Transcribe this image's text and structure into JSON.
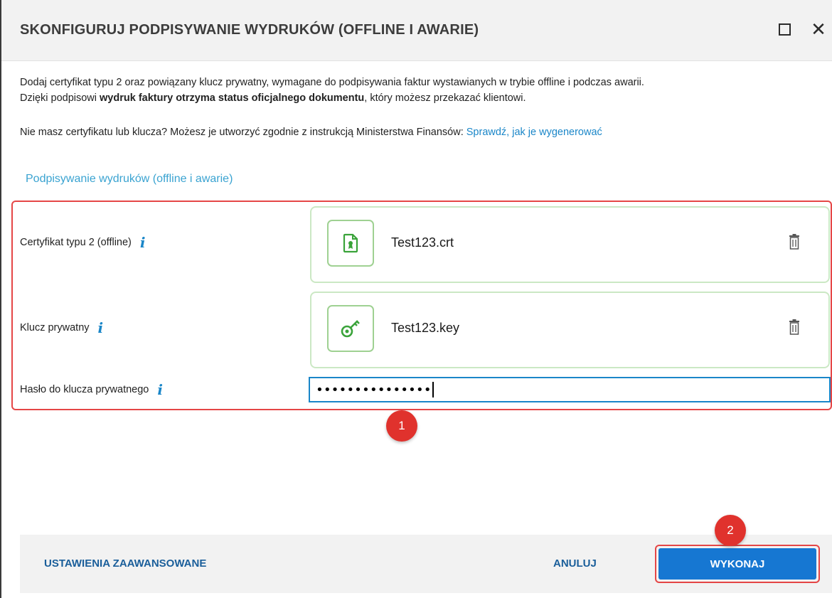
{
  "dialog": {
    "title": "SKONFIGURUJ PODPISYWANIE WYDRUKÓW (OFFLINE I AWARIE)",
    "maximize_icon": "maximize-icon",
    "close_icon": "close-icon",
    "close_glyph": "✕"
  },
  "intro": {
    "line1": "Dodaj certyfikat typu 2 oraz powiązany klucz prywatny, wymagane do podpisywania faktur wystawianych w trybie offline i podczas awarii.",
    "line2_pre": "Dzięki podpisowi ",
    "line2_bold": "wydruk faktury otrzyma status oficjalnego dokumentu",
    "line2_post": ", który możesz przekazać klientowi.",
    "help_text": "Nie masz certyfikatu lub klucza? Możesz je utworzyć zgodnie z instrukcją Ministerstwa Finansów: ",
    "help_link": "Sprawdź, jak je wygenerować"
  },
  "section": {
    "title": "Podpisywanie wydruków (offline i awarie)"
  },
  "fields": {
    "certificate": {
      "label": "Certyfikat typu 2 (offline)",
      "file_name": "Test123.crt",
      "icon": "certificate-file-icon"
    },
    "private_key": {
      "label": "Klucz prywatny",
      "file_name": "Test123.key",
      "icon": "key-icon"
    },
    "password": {
      "label": "Hasło do klucza prywatnego",
      "value": "•••••••••••••••"
    },
    "info_glyph": "i"
  },
  "badges": {
    "first": "1",
    "second": "2"
  },
  "footer": {
    "advanced_label": "USTAWIENIA ZAAWANSOWANE",
    "cancel_label": "ANULUJ",
    "execute_label": "WYKONAJ"
  },
  "colors": {
    "accent": "#1a86c8",
    "primary_button": "#1677d2",
    "highlight": "#e54646",
    "file_border": "#cbe8c4",
    "file_icon": "#3aa33a"
  }
}
